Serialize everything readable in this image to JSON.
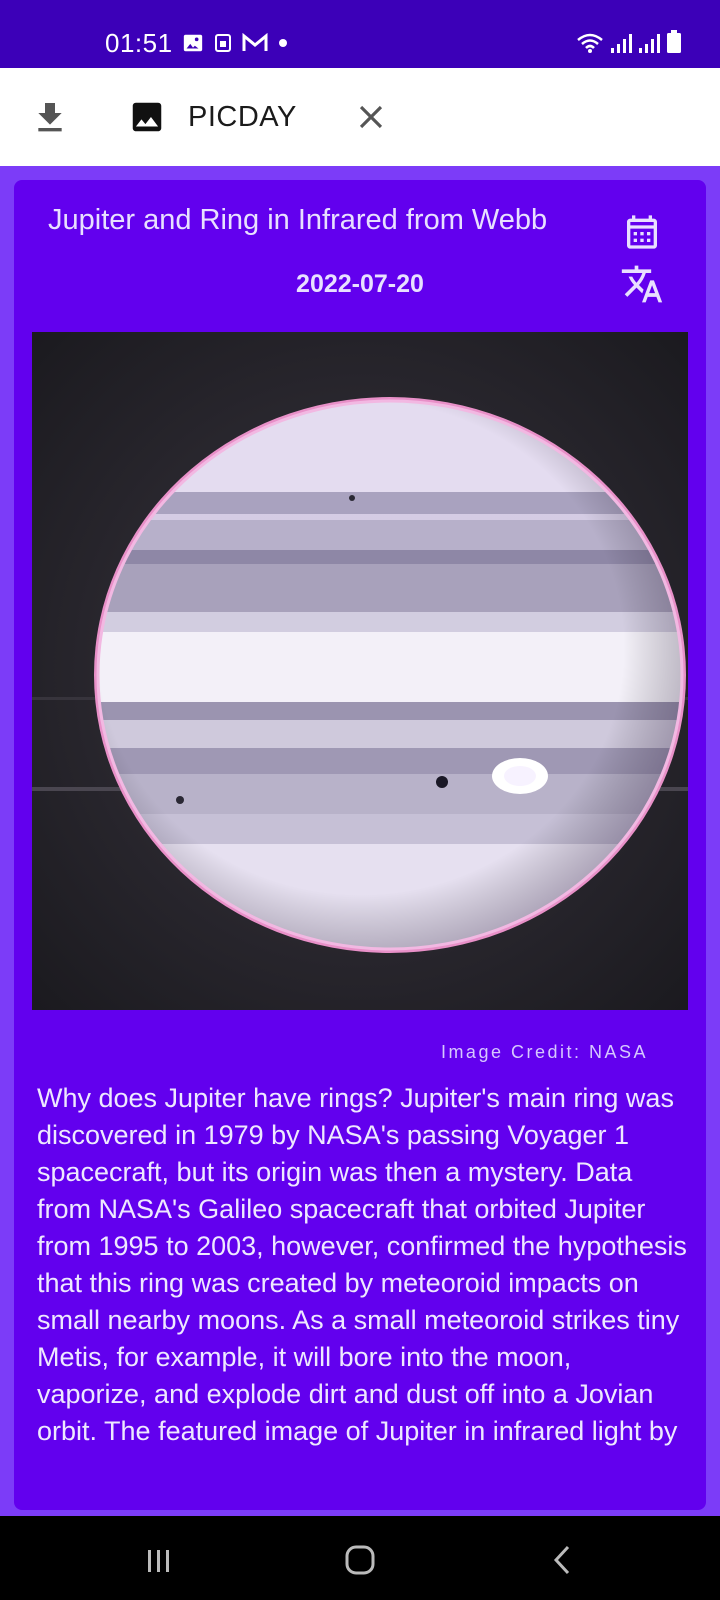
{
  "status_bar": {
    "time": "01:51",
    "left_icons": [
      "image-notification-icon",
      "sim-icon",
      "gmail-icon",
      "dot-icon"
    ],
    "right_icons": [
      "wifi-icon",
      "signal-icon",
      "signal-icon",
      "battery-icon"
    ]
  },
  "app_bar": {
    "title": "PICDAY",
    "icons": [
      "download-icon",
      "image-icon",
      "close-icon"
    ]
  },
  "picture": {
    "title": "Jupiter and Ring in Infrared from Webb",
    "date": "2022-07-20",
    "credit": "Image Credit: NASA",
    "explanation": "Why does Jupiter have rings?  Jupiter's main ring was discovered in 1979 by NASA's passing Voyager 1 spacecraft, but its origin was then a mystery.  Data from NASA's Galileo spacecraft that orbited Jupiter from 1995 to 2003, however, confirmed the hypothesis that this ring was created by meteoroid impacts on small nearby moons.  As a small meteoroid strikes tiny Metis, for example, it will bore into the moon, vaporize, and explode dirt and dust off into a Jovian orbit.  The featured image of Jupiter in infrared light by"
  },
  "card_actions": [
    "calendar-icon",
    "translate-icon"
  ],
  "nav_bar": {
    "buttons": [
      "recent-apps-icon",
      "home-icon",
      "back-icon"
    ]
  },
  "colors": {
    "status_bar": "#3c00b8",
    "app_bar": "#ffffff",
    "background": "#7c3cf8",
    "card": "#6200ee",
    "nav_bar": "#000000"
  }
}
